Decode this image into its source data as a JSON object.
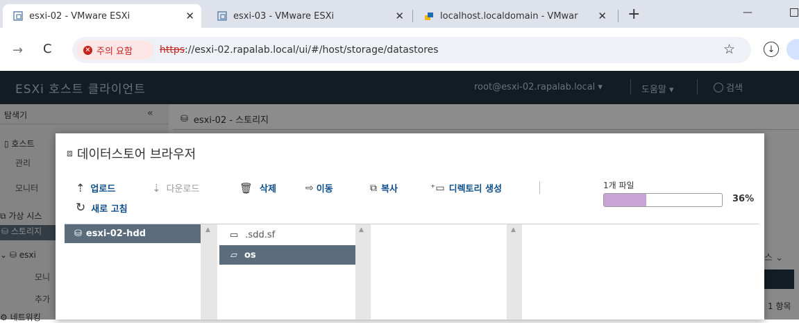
{
  "browser": {
    "tabs": [
      {
        "title": "esxi-02 - VMware ESXi",
        "active": true
      },
      {
        "title": "esxi-03 - VMware ESXi",
        "active": false
      },
      {
        "title": "localhost.localdomain - VMwar",
        "active": false
      }
    ],
    "new_tab": "+",
    "minimize": "—",
    "security_label": "주의 요함",
    "url_scheme": "https",
    "url_rest": "://esxi-02.rapalab.local/ui/#/host/storage/datastores"
  },
  "app": {
    "title": "ESXi 호스트 클라이언트",
    "user": "root@esxi-02.rapalab.local ▾",
    "help": "도움말 ▾",
    "search": "검색"
  },
  "nav": {
    "title": "탐색기",
    "collapse": "«",
    "items": [
      "호스트",
      "관리",
      "모니터",
      "가상 시스",
      "스토리지",
      "esxi",
      "모니",
      "추가",
      "네트워킹"
    ]
  },
  "content": {
    "header": "esxi-02 - 스토리지",
    "right_select": "스 ⌄",
    "item_count": "1 항목"
  },
  "modal": {
    "title": "데이터스토어 브라우저",
    "toolbar": {
      "upload": "업로드",
      "download": "다운로드",
      "delete": "삭제",
      "move": "이동",
      "copy": "복사",
      "mkdir": "디렉토리 생성",
      "refresh": "새로 고침"
    },
    "progress": {
      "label": "1개 파일",
      "percent_text": "36%",
      "value": 0.36
    },
    "datastores": [
      "esxi-02-hdd"
    ],
    "folders": [
      {
        "name": ".sdd.sf",
        "selected": false
      },
      {
        "name": "os",
        "selected": true
      }
    ]
  },
  "colors": {
    "app_header": "#213444",
    "accent_link": "#0d4d8a",
    "progress_fill": "#c9a2d6",
    "selected_row": "#5b6d7c"
  }
}
